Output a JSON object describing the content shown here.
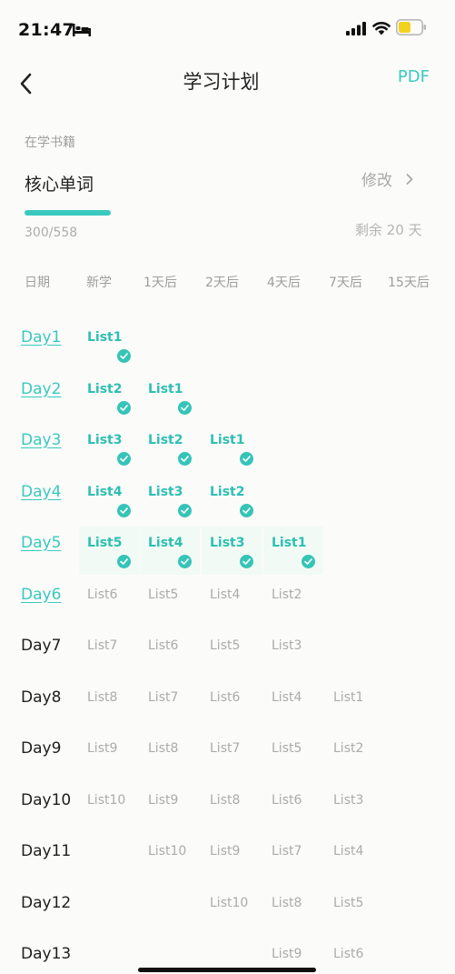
{
  "status_bar": {
    "time": "21:47"
  },
  "nav": {
    "title": "学习计划",
    "pdf_label": "PDF"
  },
  "book": {
    "section_label": "在学书籍",
    "name": "核心单词",
    "edit_label": "修改",
    "progress_text": "300/558",
    "progress_fraction": 0.54,
    "remaining": "剩余 20 天"
  },
  "colors": {
    "accent": "#39c9be",
    "muted": "#ababab",
    "active_cell_bg": "#f2faf5"
  },
  "schedule": {
    "headers": [
      "日期",
      "新学",
      "1天后",
      "2天后",
      "4天后",
      "7天后",
      "15天后"
    ],
    "rows": [
      {
        "day": "Day1",
        "status": "done",
        "lists": [
          {
            "label": "List1",
            "col": 1,
            "status": "done"
          }
        ]
      },
      {
        "day": "Day2",
        "status": "done",
        "lists": [
          {
            "label": "List2",
            "col": 1,
            "status": "done"
          },
          {
            "label": "List1",
            "col": 2,
            "status": "done"
          }
        ]
      },
      {
        "day": "Day3",
        "status": "done",
        "lists": [
          {
            "label": "List3",
            "col": 1,
            "status": "done"
          },
          {
            "label": "List2",
            "col": 2,
            "status": "done"
          },
          {
            "label": "List1",
            "col": 3,
            "status": "done"
          }
        ]
      },
      {
        "day": "Day4",
        "status": "done",
        "lists": [
          {
            "label": "List4",
            "col": 1,
            "status": "done"
          },
          {
            "label": "List3",
            "col": 2,
            "status": "done"
          },
          {
            "label": "List2",
            "col": 3,
            "status": "done"
          }
        ]
      },
      {
        "day": "Day5",
        "status": "done",
        "lists": [
          {
            "label": "List5",
            "col": 1,
            "status": "done"
          },
          {
            "label": "List4",
            "col": 2,
            "status": "done"
          },
          {
            "label": "List3",
            "col": 3,
            "status": "done"
          },
          {
            "label": "List1",
            "col": 4,
            "status": "done"
          }
        ]
      },
      {
        "day": "Day6",
        "status": "done",
        "lists": [
          {
            "label": "List6",
            "col": 1,
            "status": "pending"
          },
          {
            "label": "List5",
            "col": 2,
            "status": "pending"
          },
          {
            "label": "List4",
            "col": 3,
            "status": "pending"
          },
          {
            "label": "List2",
            "col": 4,
            "status": "pending"
          }
        ]
      },
      {
        "day": "Day7",
        "status": "pending",
        "lists": [
          {
            "label": "List7",
            "col": 1,
            "status": "pending"
          },
          {
            "label": "List6",
            "col": 2,
            "status": "pending"
          },
          {
            "label": "List5",
            "col": 3,
            "status": "pending"
          },
          {
            "label": "List3",
            "col": 4,
            "status": "pending"
          }
        ]
      },
      {
        "day": "Day8",
        "status": "pending",
        "lists": [
          {
            "label": "List8",
            "col": 1,
            "status": "pending"
          },
          {
            "label": "List7",
            "col": 2,
            "status": "pending"
          },
          {
            "label": "List6",
            "col": 3,
            "status": "pending"
          },
          {
            "label": "List4",
            "col": 4,
            "status": "pending"
          },
          {
            "label": "List1",
            "col": 5,
            "status": "pending"
          }
        ]
      },
      {
        "day": "Day9",
        "status": "pending",
        "lists": [
          {
            "label": "List9",
            "col": 1,
            "status": "pending"
          },
          {
            "label": "List8",
            "col": 2,
            "status": "pending"
          },
          {
            "label": "List7",
            "col": 3,
            "status": "pending"
          },
          {
            "label": "List5",
            "col": 4,
            "status": "pending"
          },
          {
            "label": "List2",
            "col": 5,
            "status": "pending"
          }
        ]
      },
      {
        "day": "Day10",
        "status": "pending",
        "lists": [
          {
            "label": "List10",
            "col": 1,
            "status": "pending"
          },
          {
            "label": "List9",
            "col": 2,
            "status": "pending"
          },
          {
            "label": "List8",
            "col": 3,
            "status": "pending"
          },
          {
            "label": "List6",
            "col": 4,
            "status": "pending"
          },
          {
            "label": "List3",
            "col": 5,
            "status": "pending"
          }
        ]
      },
      {
        "day": "Day11",
        "status": "pending",
        "lists": [
          {
            "label": "List10",
            "col": 2,
            "status": "pending"
          },
          {
            "label": "List9",
            "col": 3,
            "status": "pending"
          },
          {
            "label": "List7",
            "col": 4,
            "status": "pending"
          },
          {
            "label": "List4",
            "col": 5,
            "status": "pending"
          }
        ]
      },
      {
        "day": "Day12",
        "status": "pending",
        "lists": [
          {
            "label": "List10",
            "col": 3,
            "status": "pending"
          },
          {
            "label": "List8",
            "col": 4,
            "status": "pending"
          },
          {
            "label": "List5",
            "col": 5,
            "status": "pending"
          }
        ]
      },
      {
        "day": "Day13",
        "status": "pending",
        "lists": [
          {
            "label": "List9",
            "col": 4,
            "status": "pending"
          },
          {
            "label": "List6",
            "col": 5,
            "status": "pending"
          }
        ]
      }
    ]
  }
}
